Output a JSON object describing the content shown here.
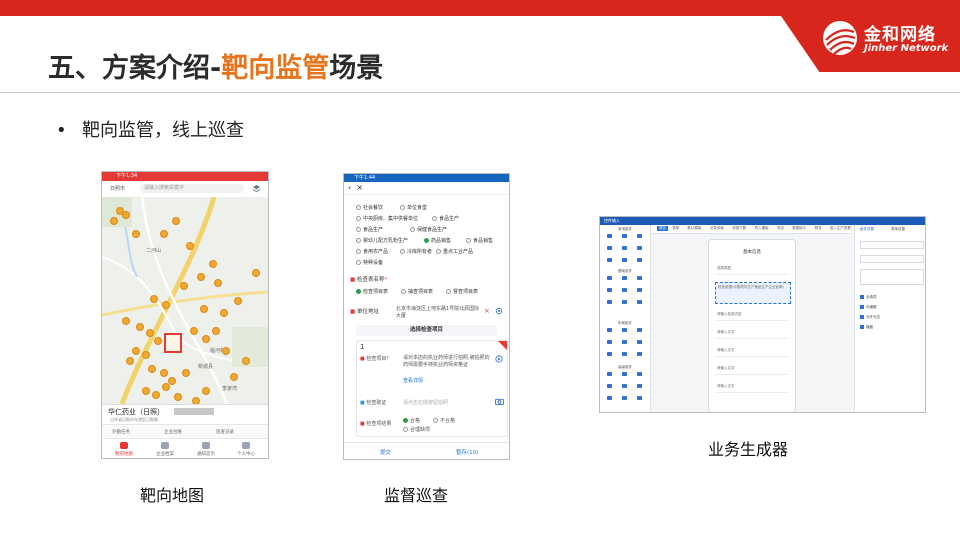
{
  "brand": {
    "name_cn": "金和网络",
    "name_en": "Jinher Network",
    "logo_icon": "jinher-globe-logo",
    "color": "#d9261c"
  },
  "slide": {
    "title_prefix": "五、方案介绍-",
    "title_highlight": "靶向监管",
    "title_suffix": "场景",
    "highlight_color": "#e8741c",
    "bullet_marker": "•",
    "bullet": "靶向监管，线上巡查"
  },
  "captions": {
    "map": "靶向地图",
    "form": "监督巡查",
    "builder": "业务生成器"
  },
  "map_app": {
    "status_time": "下午1:34",
    "city": "日照市",
    "search_placeholder": "请输入搜索关键字",
    "map_labels": [
      "二河山",
      "临河村",
      "新城县",
      "李家湾"
    ],
    "poi_count": 40,
    "selected_name": "华仁药业（日照）",
    "selected_address": "山东省日照市东港区日照路",
    "tools": [
      "外勤任务",
      "企业台账",
      "巡查记录"
    ],
    "tabs": [
      "靶向地图",
      "企业档案",
      "通知首页",
      "个人中心"
    ]
  },
  "form_app": {
    "status_time": "下午1:44",
    "nav_icons": [
      "back-arrow-icon",
      "close-icon"
    ],
    "categories": [
      {
        "label": "社会餐饮",
        "checked": false
      },
      {
        "label": "单位食堂",
        "checked": false
      },
      {
        "label": "中央厨房、集中供餐单位",
        "checked": false
      },
      {
        "label": "食品生产",
        "checked": false
      },
      {
        "label": "食品生产",
        "checked": false
      },
      {
        "label": "保健食品生产",
        "checked": false
      },
      {
        "label": "婴幼儿配方乳粉生产",
        "checked": false
      },
      {
        "label": "药品销售",
        "checked": true
      },
      {
        "label": "食品销售",
        "checked": false
      },
      {
        "label": "食用农产品",
        "checked": false
      },
      {
        "label": "冷库所有者",
        "checked": false
      },
      {
        "label": "重点工业产品",
        "checked": false
      },
      {
        "label": "特种设备",
        "checked": false
      }
    ],
    "table_name_label": "检查表名称",
    "table_types": [
      {
        "label": "检查项目表",
        "checked": true
      },
      {
        "label": "抽查项目表",
        "checked": false
      },
      {
        "label": "督查项目表",
        "checked": false
      }
    ],
    "address_label": "单位地址",
    "address_value": "北京市海淀区上地东路1号院北辰国际大厦",
    "select_button": "选择检查项目",
    "item_number": "1",
    "item_label": "检查项目",
    "item_text": "请对本店的执业药师进行拍照,被拍照的药师需要手持执业药师资格证",
    "item_link": "查看详情",
    "evidence_label": "检查取证",
    "evidence_placeholder": "请点击右侧按钮拍照",
    "result_label": "检查项结果",
    "results": [
      {
        "label": "合格",
        "checked": true
      },
      {
        "label": "不合格",
        "checked": false
      },
      {
        "label": "合理缺项",
        "checked": false
      }
    ],
    "submit_label": "提交",
    "save_label": "暂存(10)"
  },
  "builder_app": {
    "top_title": "控件输入",
    "tabs": [
      "报告",
      "表单",
      "默认模板",
      "记录页面",
      "资源下载",
      "导入模板",
      "导出",
      "数据统计",
      "预览",
      "进入生产查看"
    ],
    "active_tab": "报告",
    "left_groups": [
      "常用组件",
      "基础组件",
      "布局组件",
      "高级组件"
    ],
    "canvas_title": "基本信息",
    "canvas_fields": [
      "选择类型",
      "检查依据(中国境内生产食品生产企业证明)",
      "请输入检查内容",
      "请输入文字",
      "请输入文字",
      "请输入文字",
      "请输入文字"
    ],
    "right_tabs": [
      "组件设置",
      "表单设置"
    ],
    "right_options": [
      "必填项",
      "可编辑",
      "允许为空",
      "隐藏"
    ],
    "accent": "#2f6fd6"
  }
}
